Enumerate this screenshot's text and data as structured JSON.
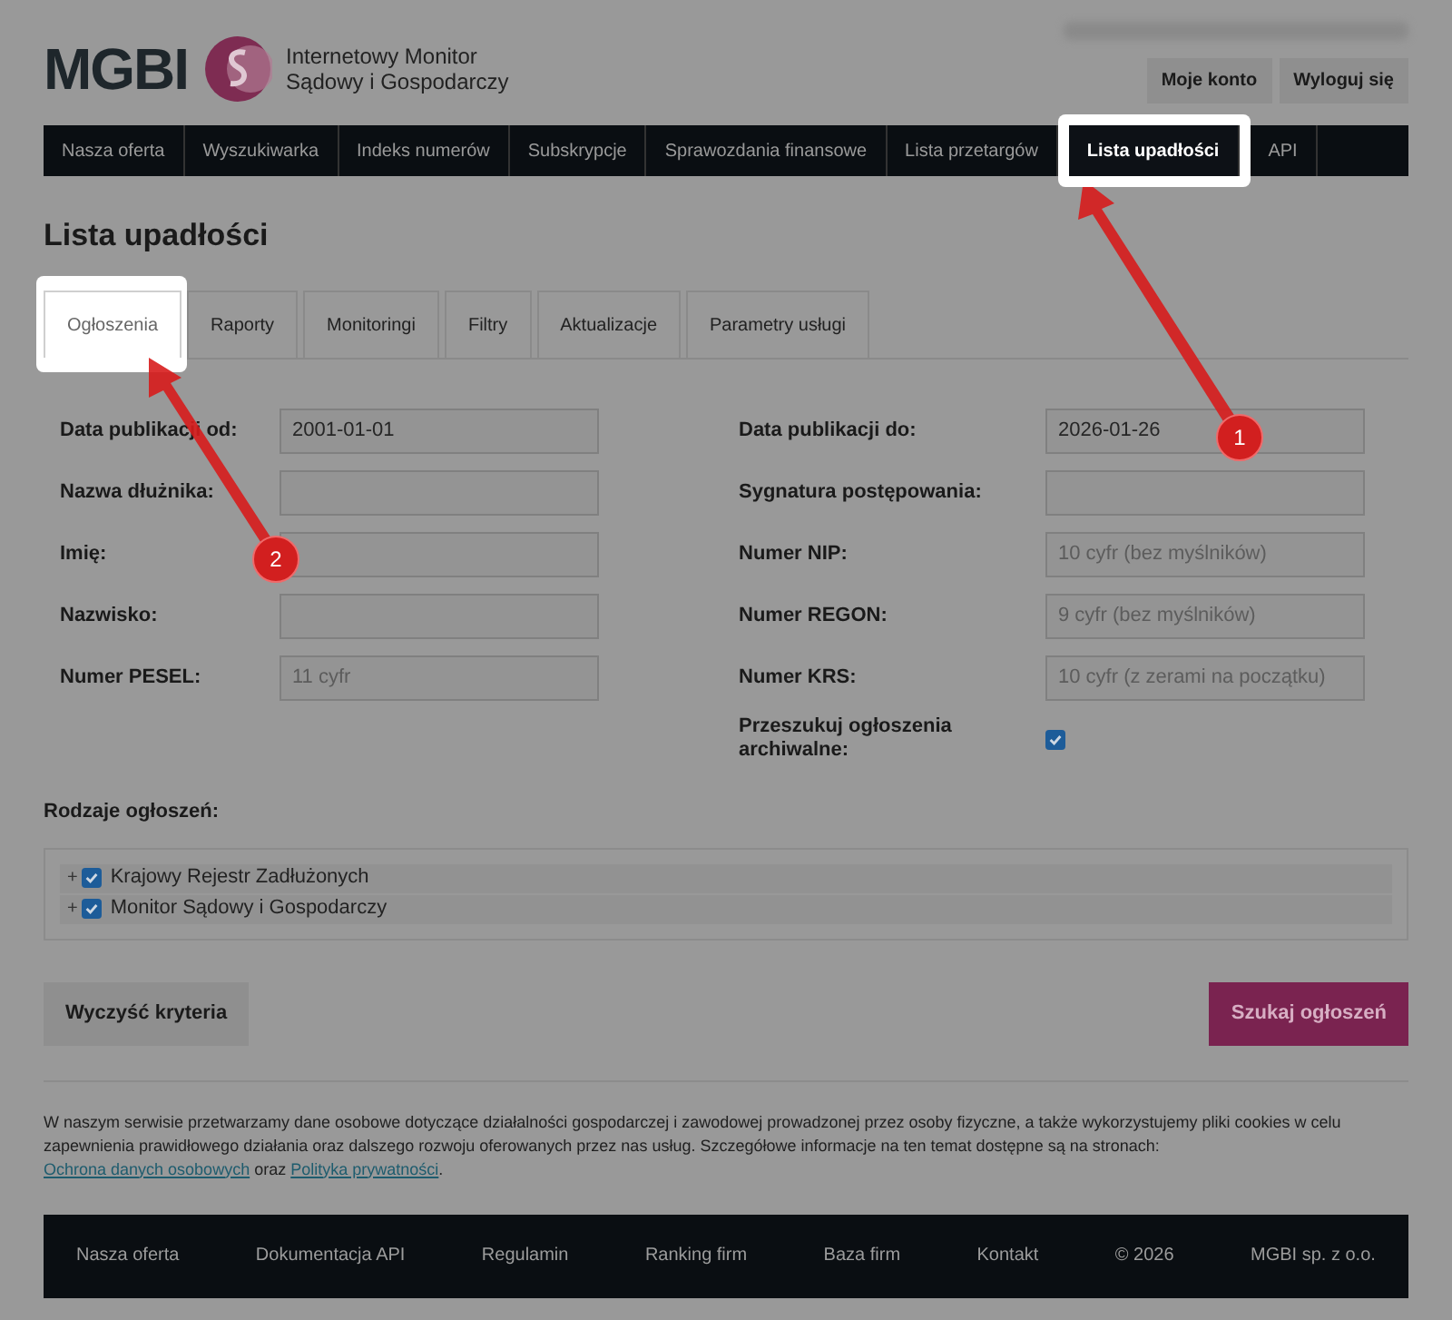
{
  "header": {
    "logo": "MGBI",
    "tagline": [
      "Internetowy Monitor",
      "Sądowy i Gospodarczy"
    ],
    "buttons": [
      "Moje konto",
      "Wyloguj się"
    ]
  },
  "nav": [
    {
      "label": "Nasza oferta",
      "selected": false,
      "highlighted": false
    },
    {
      "label": "Wyszukiwarka",
      "selected": false,
      "highlighted": false
    },
    {
      "label": "Indeks numerów",
      "selected": false,
      "highlighted": false
    },
    {
      "label": "Subskrypcje",
      "selected": false,
      "highlighted": false
    },
    {
      "label": "Sprawozdania finansowe",
      "selected": false,
      "highlighted": false
    },
    {
      "label": "Lista przetargów",
      "selected": false,
      "highlighted": false
    },
    {
      "label": "Lista upadłości",
      "selected": true,
      "highlighted": true
    },
    {
      "label": "API",
      "selected": false,
      "highlighted": false
    }
  ],
  "page_title": "Lista upadłości",
  "tabs": [
    {
      "label": "Ogłoszenia",
      "selected": true,
      "highlighted": true
    },
    {
      "label": "Raporty",
      "selected": false,
      "highlighted": false
    },
    {
      "label": "Monitoringi",
      "selected": false,
      "highlighted": false
    },
    {
      "label": "Filtry",
      "selected": false,
      "highlighted": false
    },
    {
      "label": "Aktualizacje",
      "selected": false,
      "highlighted": false
    },
    {
      "label": "Parametry usługi",
      "selected": false,
      "highlighted": false
    }
  ],
  "form_left": [
    {
      "kind": "input",
      "label": "Data publikacji od:",
      "value": "2001-01-01"
    },
    {
      "kind": "input",
      "label": "Nazwa dłużnika:"
    },
    {
      "kind": "input",
      "label": "Imię:"
    },
    {
      "kind": "input",
      "label": "Nazwisko:"
    },
    {
      "kind": "input",
      "label": "Numer PESEL:",
      "placeholder": "11 cyfr"
    }
  ],
  "form_right": [
    {
      "kind": "input",
      "label": "Data publikacji do:",
      "value": "2026-01-26"
    },
    {
      "kind": "input",
      "label": "Sygnatura postępowania:"
    },
    {
      "kind": "input",
      "label": "Numer NIP:",
      "placeholder": "10 cyfr (bez myślników)"
    },
    {
      "kind": "input",
      "label": "Numer REGON:",
      "placeholder": "9 cyfr (bez myślników)"
    },
    {
      "kind": "input",
      "label": "Numer KRS:",
      "placeholder": "10 cyfr (z zerami na początku)"
    },
    {
      "kind": "checkbox",
      "label": "Przeszukuj ogłoszenia archiwalne:",
      "checked": true
    }
  ],
  "types": {
    "title": "Rodzaje ogłoszeń:",
    "items": [
      {
        "expander": "+",
        "label": "Krajowy Rejestr Zadłużonych",
        "checked": true
      },
      {
        "expander": "+",
        "label": "Monitor Sądowy i Gospodarczy",
        "checked": true
      }
    ]
  },
  "actions": {
    "clear": "Wyczyść kryteria",
    "search": "Szukaj ogłoszeń"
  },
  "notice": {
    "text": "W naszym serwisie przetwarzamy dane osobowe dotyczące działalności gospodarczej i zawodowej prowadzonej przez osoby fizyczne, a także wykorzystujemy pliki cookies w celu zapewnienia prawidłowego działania oraz dalszego rozwoju oferowanych przez nas usług. Szczegółowe informacje na ten temat dostępne są na stronach:",
    "link1": "Ochrona danych osobowych",
    "joiner": "oraz",
    "link2": "Polityka prywatności",
    "end": "."
  },
  "footer": [
    "Nasza oferta",
    "Dokumentacja API",
    "Regulamin",
    "Ranking firm",
    "Baza firm",
    "Kontakt",
    "© 2026",
    "MGBI sp. z o.o."
  ],
  "callouts": [
    {
      "number": "1"
    },
    {
      "number": "2"
    }
  ]
}
